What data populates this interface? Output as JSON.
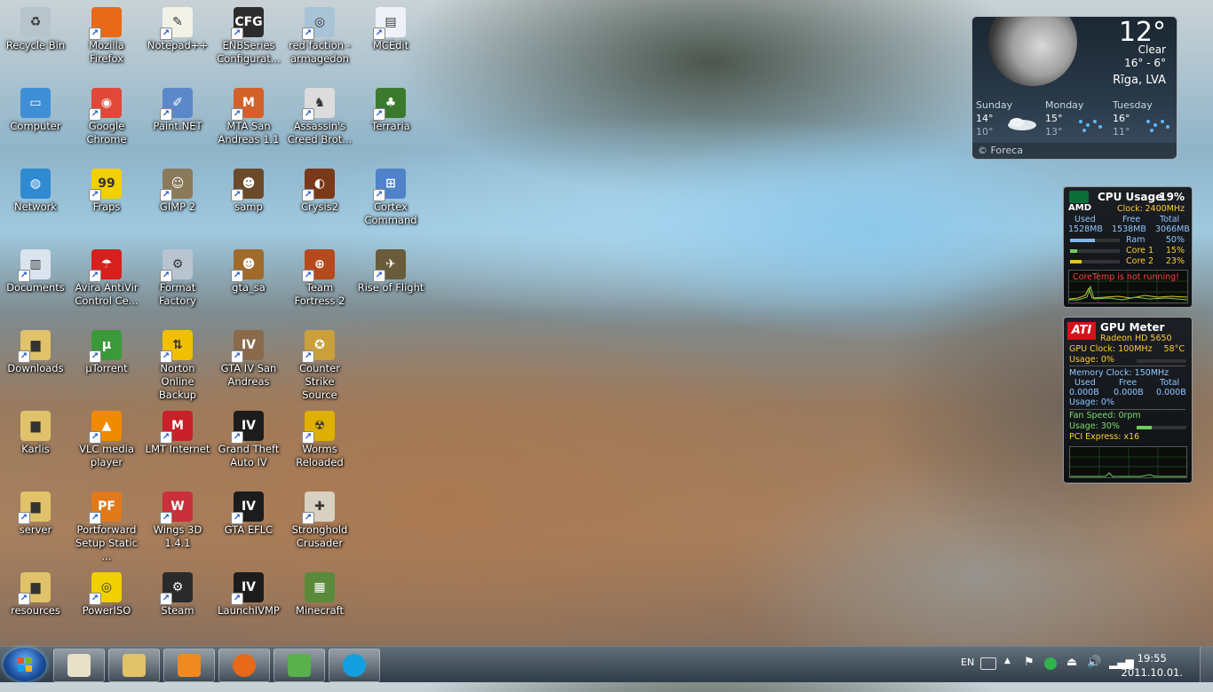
{
  "desktop": {
    "icons": [
      {
        "label": "Recycle Bin",
        "icon": "recycle-bin-icon",
        "color": "#b8c4cc",
        "glyph": "♻",
        "shortcut": false
      },
      {
        "label": "Mozilla Firefox",
        "icon": "firefox-icon",
        "color": "#e66a1a",
        "glyph": "",
        "shortcut": true
      },
      {
        "label": "Notepad++",
        "icon": "notepad-plus-plus-icon",
        "color": "#f2f2e6",
        "glyph": "✎",
        "shortcut": true
      },
      {
        "label": "ENBSeries Configurat...",
        "icon": "enbseries-icon",
        "color": "#2c2c2c",
        "glyph": "CFG",
        "shortcut": true
      },
      {
        "label": "red faction - armagedon",
        "icon": "red-faction-icon",
        "color": "#a9c3d6",
        "glyph": "◎",
        "shortcut": true
      },
      {
        "label": "MCEdit",
        "icon": "mcedit-icon",
        "color": "#eef2f8",
        "glyph": "▤",
        "shortcut": true
      },
      {
        "label": "Computer",
        "icon": "computer-icon",
        "color": "#3f8fd6",
        "glyph": "▭",
        "shortcut": false
      },
      {
        "label": "Google Chrome",
        "icon": "chrome-icon",
        "color": "#e0483a",
        "glyph": "◉",
        "shortcut": true
      },
      {
        "label": "Paint.NET",
        "icon": "paint-net-icon",
        "color": "#5b88c9",
        "glyph": "✐",
        "shortcut": true
      },
      {
        "label": "MTA San Andreas 1.1",
        "icon": "mta-icon",
        "color": "#d4602a",
        "glyph": "M",
        "shortcut": true
      },
      {
        "label": "Assassin's Creed Brot...",
        "icon": "assassins-creed-icon",
        "color": "#dcdcdc",
        "glyph": "♞",
        "shortcut": true
      },
      {
        "label": "Terraria",
        "icon": "terraria-icon",
        "color": "#3b7a2e",
        "glyph": "♣",
        "shortcut": true
      },
      {
        "label": "Network",
        "icon": "network-icon",
        "color": "#2f8ad1",
        "glyph": "◍",
        "shortcut": false
      },
      {
        "label": "Fraps",
        "icon": "fraps-icon",
        "color": "#f0d000",
        "glyph": "99",
        "shortcut": true
      },
      {
        "label": "GIMP 2",
        "icon": "gimp-icon",
        "color": "#8a7a5a",
        "glyph": "☺",
        "shortcut": true
      },
      {
        "label": "samp",
        "icon": "samp-icon",
        "color": "#6b4a2a",
        "glyph": "☻",
        "shortcut": true
      },
      {
        "label": "Crysis2",
        "icon": "crysis2-icon",
        "color": "#7a3a1a",
        "glyph": "◐",
        "shortcut": true
      },
      {
        "label": "Cortex Command",
        "icon": "cortex-command-icon",
        "color": "#4f82c9",
        "glyph": "⊞",
        "shortcut": true
      },
      {
        "label": "Documents",
        "icon": "documents-icon",
        "color": "#d9e4ee",
        "glyph": "▥",
        "shortcut": true
      },
      {
        "label": "Avira AntiVir Control Ce...",
        "icon": "avira-icon",
        "color": "#d6201e",
        "glyph": "☂",
        "shortcut": true
      },
      {
        "label": "Format Factory",
        "icon": "format-factory-icon",
        "color": "#b9c4d1",
        "glyph": "⚙",
        "shortcut": true
      },
      {
        "label": "gta_sa",
        "icon": "gta-sa-icon",
        "color": "#a06a2a",
        "glyph": "☻",
        "shortcut": true
      },
      {
        "label": "Team Fortress 2",
        "icon": "team-fortress-2-icon",
        "color": "#b54a1c",
        "glyph": "⊕",
        "shortcut": true
      },
      {
        "label": "Rise of Flight",
        "icon": "rise-of-flight-icon",
        "color": "#6a5b3a",
        "glyph": "✈",
        "shortcut": true
      },
      {
        "label": "Downloads",
        "icon": "downloads-folder-icon",
        "color": "#e0c26a",
        "glyph": "▆",
        "shortcut": true
      },
      {
        "label": "µTorrent",
        "icon": "utorrent-icon",
        "color": "#3a9a3a",
        "glyph": "µ",
        "shortcut": true
      },
      {
        "label": "Norton Online Backup",
        "icon": "norton-backup-icon",
        "color": "#f0c000",
        "glyph": "⇅",
        "shortcut": true
      },
      {
        "label": "GTA IV San Andreas",
        "icon": "gta-iv-san-andreas-icon",
        "color": "#8a6a4a",
        "glyph": "IV",
        "shortcut": true
      },
      {
        "label": "Counter Strike Source",
        "icon": "counter-strike-icon",
        "color": "#c9a03a",
        "glyph": "✪",
        "shortcut": true
      },
      {
        "label": "Karlis",
        "icon": "user-folder-icon",
        "color": "#e0c26a",
        "glyph": "▆",
        "shortcut": false
      },
      {
        "label": "VLC media player",
        "icon": "vlc-icon",
        "color": "#f08a00",
        "glyph": "▲",
        "shortcut": true
      },
      {
        "label": "LMT Internet",
        "icon": "lmt-internet-icon",
        "color": "#c9202a",
        "glyph": "M",
        "shortcut": true
      },
      {
        "label": "Grand Theft Auto IV",
        "icon": "gta-iv-icon",
        "color": "#1c1c1c",
        "glyph": "IV",
        "shortcut": true
      },
      {
        "label": "Worms Reloaded",
        "icon": "worms-reloaded-icon",
        "color": "#e0b000",
        "glyph": "☢",
        "shortcut": true
      },
      {
        "label": "server",
        "icon": "server-folder-icon",
        "color": "#e0c26a",
        "glyph": "▆",
        "shortcut": true
      },
      {
        "label": "Portforward Setup Static ...",
        "icon": "portforward-icon",
        "color": "#e07a1a",
        "glyph": "PF",
        "shortcut": true
      },
      {
        "label": "Wings 3D 1.4.1",
        "icon": "wings-3d-icon",
        "color": "#c9303a",
        "glyph": "W",
        "shortcut": true
      },
      {
        "label": "GTA EFLC",
        "icon": "gta-eflc-icon",
        "color": "#1c1c1c",
        "glyph": "IV",
        "shortcut": true
      },
      {
        "label": "Stronghold Crusader",
        "icon": "stronghold-crusader-icon",
        "color": "#d8d0c0",
        "glyph": "✚",
        "shortcut": true
      },
      {
        "label": "resources",
        "icon": "resources-folder-icon",
        "color": "#e0c26a",
        "glyph": "▆",
        "shortcut": true
      },
      {
        "label": "PowerISO",
        "icon": "poweriso-icon",
        "color": "#f0d000",
        "glyph": "◎",
        "shortcut": true
      },
      {
        "label": "Steam",
        "icon": "steam-icon",
        "color": "#2a2a2a",
        "glyph": "⚙",
        "shortcut": true
      },
      {
        "label": "LaunchIVMP",
        "icon": "launch-ivmp-icon",
        "color": "#1c1c1c",
        "glyph": "IV",
        "shortcut": true
      },
      {
        "label": "Minecraft",
        "icon": "minecraft-icon",
        "color": "#5a8a3a",
        "glyph": "▦",
        "shortcut": false
      }
    ]
  },
  "weather": {
    "temp": "12°",
    "condition": "Clear",
    "range": "16° - 6°",
    "city": "Rīga, LVA",
    "days": [
      {
        "name": "Sunday",
        "hi": "14°",
        "lo": "10°",
        "icon": "cloudy-icon"
      },
      {
        "name": "Monday",
        "hi": "15°",
        "lo": "13°",
        "icon": "rain-icon"
      },
      {
        "name": "Tuesday",
        "hi": "16°",
        "lo": "11°",
        "icon": "rain-icon"
      }
    ],
    "provider": "© Foreca"
  },
  "cpu": {
    "title": "CPU Usage",
    "usage": "19%",
    "brand": "AMD",
    "clock_label": "Clock:",
    "clock": "2400MHz",
    "mem_headers": [
      "Used",
      "Free",
      "Total"
    ],
    "mem_values": [
      "1528MB",
      "1538MB",
      "3066MB"
    ],
    "bars": [
      {
        "label": "Ram",
        "value": "50%",
        "pct": 50
      },
      {
        "label": "Core 1",
        "value": "15%",
        "pct": 15
      },
      {
        "label": "Core 2",
        "value": "23%",
        "pct": 23
      }
    ],
    "warning": "CoreTemp is not running!"
  },
  "gpu": {
    "title": "GPU Meter",
    "brand": "ATI",
    "model": "Radeon HD 5650",
    "gpu_clock": "GPU Clock: 100MHz",
    "temp": "58°C",
    "gpu_usage": "Usage: 0%",
    "mem_clock": "Memory Clock: 150MHz",
    "mem_headers": [
      "Used",
      "Free",
      "Total"
    ],
    "mem_values": [
      "0.000B",
      "0.000B",
      "0.000B"
    ],
    "mem_usage": "Usage: 0%",
    "fan": "Fan Speed: 0rpm",
    "fan_usage": "Usage: 30%",
    "fan_pct": 30,
    "pci": "PCI Express: x16"
  },
  "taskbar": {
    "pinned": [
      {
        "name": "notepad-icon",
        "color": "#e8e0c8"
      },
      {
        "name": "explorer-icon",
        "color": "#e0c26a"
      },
      {
        "name": "media-player-icon",
        "color": "#f08a20"
      },
      {
        "name": "firefox-icon",
        "color": "#e66a1a"
      },
      {
        "name": "messenger-icon",
        "color": "#5ab04a"
      },
      {
        "name": "skype-icon",
        "color": "#14a0e0"
      }
    ],
    "language": "EN",
    "time": "19:55",
    "date": "2011.10.01."
  }
}
